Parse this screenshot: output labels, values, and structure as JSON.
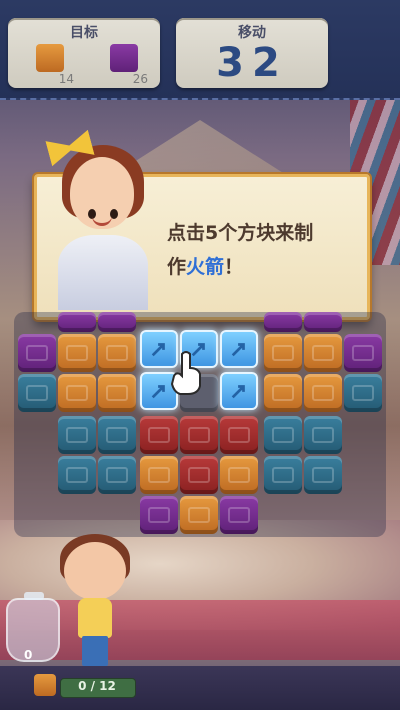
{
  "topbar": {
    "goal_title": "目标",
    "goals": [
      {
        "color": "#d7862f",
        "count": "14"
      },
      {
        "color": "#7a2f9a",
        "count": "26"
      }
    ],
    "moves_title": "移动",
    "moves_value": "32"
  },
  "dialog": {
    "line1": "点击5个方块来制",
    "line2_prefix": "作",
    "line2_highlight": "火箭",
    "line2_suffix": "！"
  },
  "jar": {
    "count": "0"
  },
  "progress": {
    "text": "0 / 12",
    "fraction": 0
  }
}
